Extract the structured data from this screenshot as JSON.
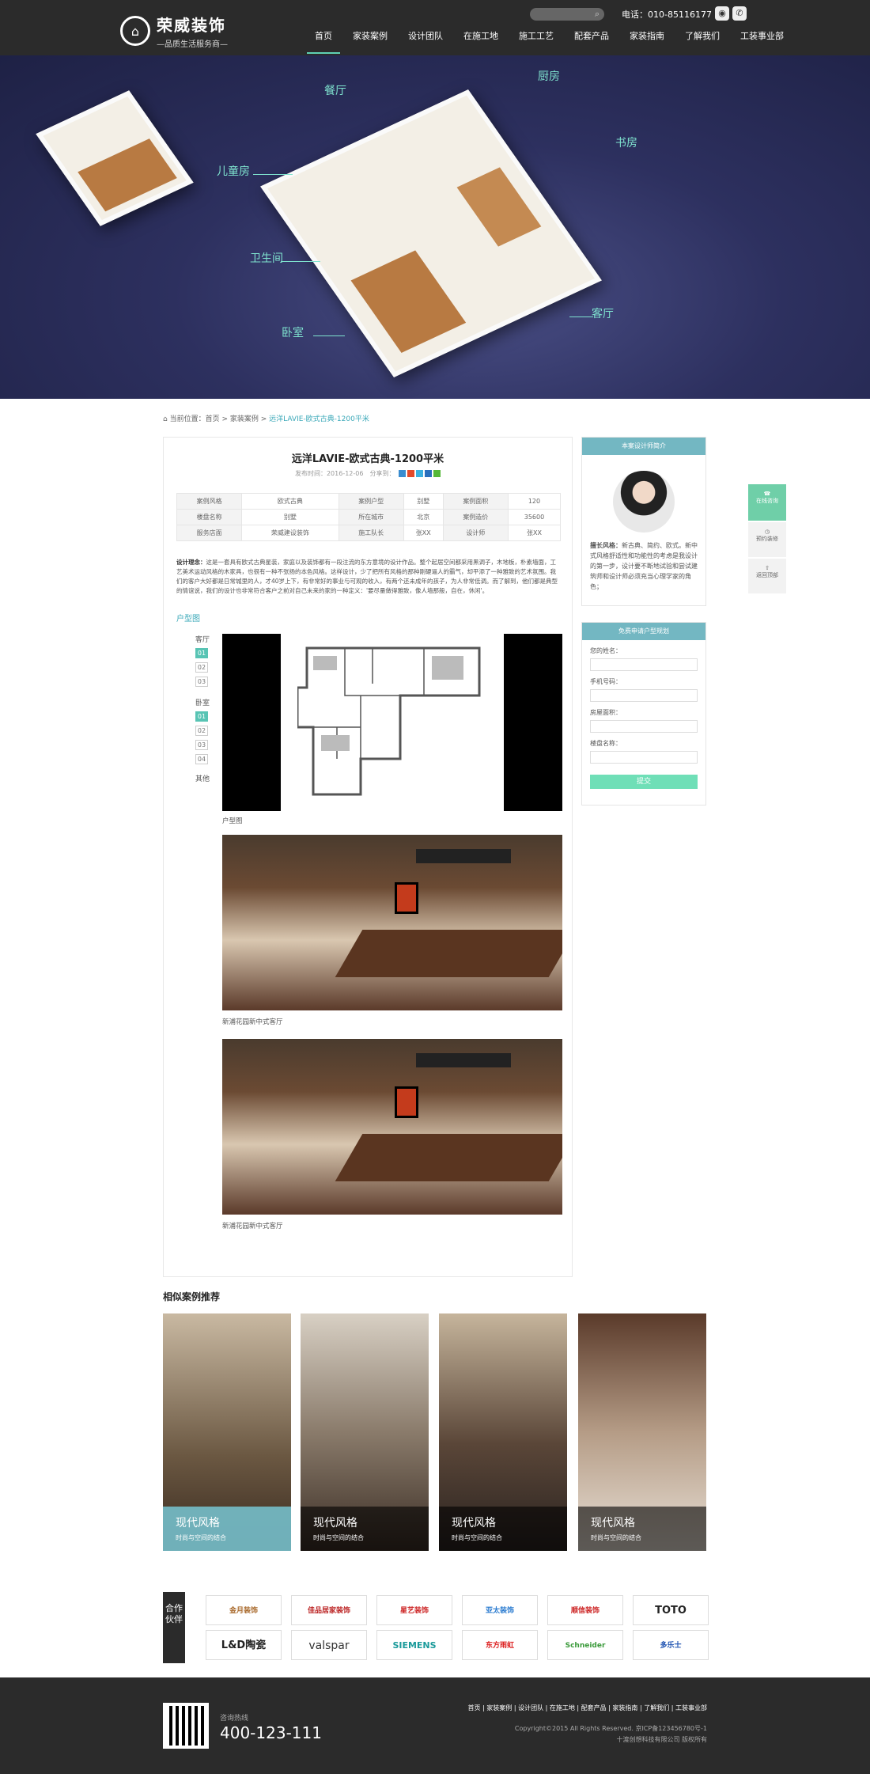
{
  "header": {
    "brand": "荣威装饰",
    "slogan": "—品质生活服务商—",
    "phone": "电话：010-85116177",
    "nav": [
      "首页",
      "家装案例",
      "设计团队",
      "在施工地",
      "施工工艺",
      "配套产品",
      "家装指南",
      "了解我们",
      "工装事业部"
    ]
  },
  "hero": {
    "labels": [
      "餐厅",
      "厨房",
      "书房",
      "儿童房",
      "卫生间",
      "卧室",
      "客厅"
    ]
  },
  "breadcrumb": {
    "prefix": "当前位置：首页 > 家装案例 >",
    "current": "远洋LAVIE-欧式古典-1200平米"
  },
  "article": {
    "title": "远洋LAVIE-欧式古典-1200平米",
    "meta": "发布时间：2016-12-06",
    "share": "分享到：",
    "info": [
      [
        "案例风格",
        "欧式古典",
        "案例户型",
        "别墅",
        "案例面积",
        "120"
      ],
      [
        "楼盘名称",
        "别墅",
        "所在城市",
        "北京",
        "案例造价",
        "35600"
      ],
      [
        "服务店面",
        "荣威建设装饰",
        "施工队长",
        "张XX",
        "设计师",
        "张XX"
      ]
    ],
    "desc_label": "设计理念：",
    "desc": "这是一套具有欧式古典星装，家庭以及装饰都有一段注流的东方意境的设计作品。整个起居空间都采用黑调子，木地板，朴素墙面，工艺美术运动风格的木家具，也很有一种不张扬的本色风格。这样设计，少了把所有风格的那种刚硬逼人的霸气，却平添了一种雅致的艺术氛围。我们的客户大好都是日常城里的人，才40岁上下，有非常好的事业与可观的收入，有两个还未成年的孩子，为人非常低调。而了解到，他们都是典型的情谊说，我们的设计也非常符合客户之前对自己未来的家的一种定义：'要尽量做得雅致，像人墙那般，自在，休闲'。",
    "section": "户型图",
    "side_a": "客厅",
    "side_b": "卧室",
    "side_c": "其他",
    "nums_a": [
      "01",
      "02",
      "03"
    ],
    "nums_b": [
      "01",
      "02",
      "03",
      "04"
    ],
    "cap_plan": "户型图",
    "cap_photo1": "新浦花园新中式客厅",
    "cap_photo2": "新浦花园新中式客厅"
  },
  "sidebar": {
    "designer_head": "本案设计师简介",
    "designer_label": "擅长风格：",
    "designer_text": "新古典、简约、欧式。新中式风格舒适性和功能性的考虑是我设计的第一步，设计要不断地试验和尝试建筑师和设计师必须充当心理学家的角色；",
    "form_head": "免费申请户型规划",
    "fields": [
      "您的姓名：",
      "手机号码：",
      "房屋面积：",
      "楼盘名称："
    ],
    "submit": "提交"
  },
  "float": [
    "在线咨询",
    "预约装修",
    "返回顶部"
  ],
  "similar": {
    "title": "相似案例推荐",
    "cases": [
      {
        "name": "现代风格",
        "sub": "时尚与空间的结合"
      },
      {
        "name": "现代风格",
        "sub": "时尚与空间的结合"
      },
      {
        "name": "现代风格",
        "sub": "时尚与空间的结合"
      },
      {
        "name": "现代风格",
        "sub": "时尚与空间的结合"
      }
    ]
  },
  "partners": {
    "tag": "合作伙伴",
    "logos": [
      "金月装饰",
      "佳品居家装饰",
      "星艺装饰",
      "亚太装饰",
      "顺信装饰",
      "TOTO",
      "L&D陶瓷",
      "valspar",
      "SIEMENS",
      "东方雨虹",
      "Schneider",
      "多乐士"
    ]
  },
  "footer": {
    "hotline_label": "咨询热线",
    "hotline": "400-123-111",
    "nav": "首页 | 家装案例 | 设计团队 | 在施工地 | 配套产品 | 家装指南 | 了解我们 | 工装事业部",
    "copy1": "Copyright©2015 All Rights Reserved. 京ICP备123456780号-1",
    "copy2": "十渡创想科技有限公司 版权所有"
  }
}
